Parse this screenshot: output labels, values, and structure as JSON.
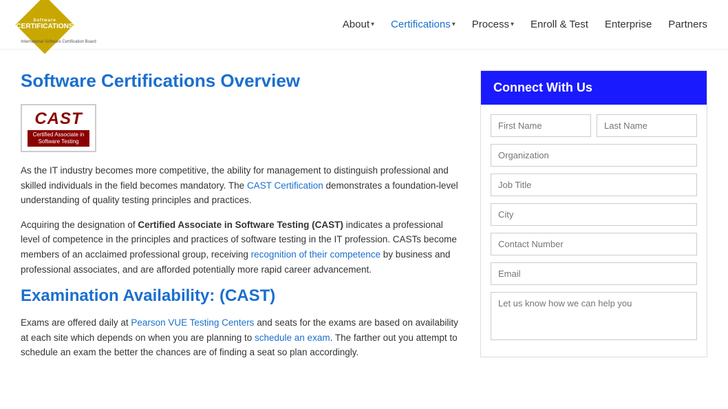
{
  "header": {
    "logo": {
      "line1": "Software",
      "line2": "CERTIFICATIONS",
      "subtitle": "International Software Certification Board"
    },
    "nav": [
      {
        "label": "About",
        "has_dropdown": true,
        "active": false
      },
      {
        "label": "Certifications",
        "has_dropdown": true,
        "active": true
      },
      {
        "label": "Process",
        "has_dropdown": true,
        "active": false
      },
      {
        "label": "Enroll & Test",
        "has_dropdown": false,
        "active": false
      },
      {
        "label": "Enterprise",
        "has_dropdown": false,
        "active": false
      },
      {
        "label": "Partners",
        "has_dropdown": false,
        "active": false
      }
    ]
  },
  "main": {
    "page_title": "Software Certifications Overview",
    "cast_logo": {
      "acronym": "CAST",
      "subtitle": "Certified Associate in\nSoftware Testing"
    },
    "paragraphs": [
      "As the IT industry becomes more competitive, the ability for management to distinguish professional and skilled individuals in the field becomes mandatory. The CAST Certification demonstrates a foundation-level understanding of quality testing principles and practices.",
      "Acquiring the designation of Certified Associate in Software Testing (CAST) indicates a professional level of competence in the principles and practices of software testing in the IT profession. CASTs become members of an acclaimed professional group, receiving recognition of their competence by business and professional associates, and are afforded potentially more rapid career advancement."
    ],
    "section2_title": "Examination Availability: (CAST)",
    "section2_text": "Exams are offered daily at Pearson VUE Testing Centers and seats for the exams are based on availability at each site which depends on when you are planning to schedule an exam. The farther out you attempt to schedule an exam the better the chances are of finding a seat so plan accordingly."
  },
  "sidebar": {
    "connect_header": "Connect With Us",
    "form": {
      "first_name_placeholder": "First Name",
      "last_name_placeholder": "Last Name",
      "organization_placeholder": "Organization",
      "job_title_placeholder": "Job Title",
      "city_placeholder": "City",
      "contact_number_placeholder": "Contact Number",
      "email_placeholder": "Email",
      "message_placeholder": "Let us know how we can help you"
    }
  }
}
